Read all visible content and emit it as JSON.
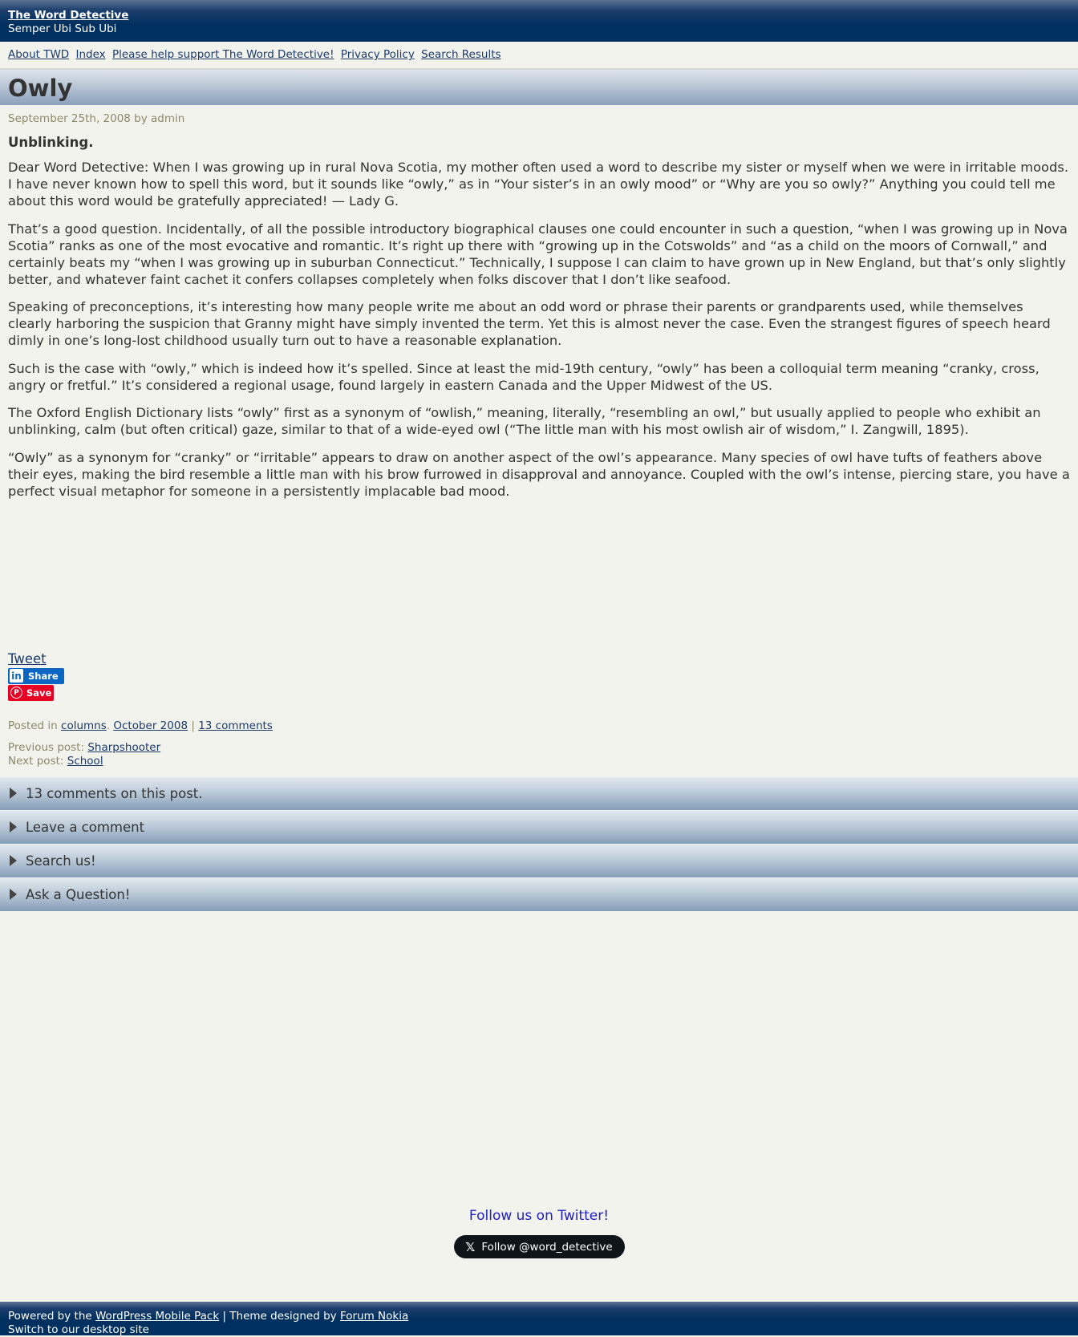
{
  "header": {
    "site_title": "The Word Detective",
    "tagline": "Semper Ubi Sub Ubi"
  },
  "nav": {
    "items": [
      "About TWD",
      "Index",
      "Please help support The Word Detective!",
      "Privacy Policy",
      "Search Results"
    ]
  },
  "post": {
    "title": "Owly",
    "meta": "September 25th, 2008 by admin",
    "subtitle": "Unblinking.",
    "paragraphs": [
      "Dear Word Detective: When I was growing up in rural Nova Scotia, my mother often used a word to describe my sister or myself when we were in irritable moods. I have never known how to spell this word, but it sounds like “owly,” as in “Your sister’s in an owly mood” or “Why are you so owly?” Anything you could tell me about this word would be gratefully appreciated! — Lady G.",
      "That’s a good question. Incidentally, of all the possible introductory biographical clauses one could encounter in such a question, “when I was growing up in Nova Scotia” ranks as one of the most evocative and romantic. It’s right up there with “growing up in the Cotswolds” and “as a child on the moors of Cornwall,” and certainly beats my “when I was growing up in suburban Connecticut.” Technically, I suppose I can claim to have grown up in New England, but that’s only slightly better, and whatever faint cachet it confers collapses completely when folks discover that I don’t like seafood.",
      "Speaking of preconceptions, it’s interesting how many people write me about an odd word or phrase their parents or grandparents used, while themselves clearly harboring the suspicion that Granny might have simply invented the term. Yet this is almost never the case. Even the strangest figures of speech heard dimly in one’s long-lost childhood usually turn out to have a reasonable explanation.",
      "Such is the case with “owly,” which is indeed how it’s spelled. Since at least the mid-19th century, “owly” has been a colloquial term meaning “cranky, cross, angry or fretful.” It’s considered a regional usage, found largely in eastern Canada and the Upper Midwest of the US.",
      "The Oxford English Dictionary lists “owly” first as a synonym of “owlish,” meaning, literally, “resembling an owl,” but usually applied to people who exhibit an unblinking, calm (but often critical) gaze, similar to that of a wide-eyed owl (“The little man with his most owlish air of wisdom,” I. Zangwill, 1895).",
      "“Owly” as a synonym for “cranky” or “irritable” appears to draw on another aspect of the owl’s appearance. Many species of owl have tufts of feathers above their eyes, making the bird resemble a little man with his brow furrowed in disapproval and annoyance. Coupled with the owl’s intense, piercing stare, you have a perfect visual metaphor for someone in a persistently implacable bad mood."
    ]
  },
  "share": {
    "tweet": "Tweet",
    "linkedin_icon": "in",
    "linkedin": "Share",
    "pinterest_icon": "P",
    "pinterest": "Save"
  },
  "post_footer": {
    "posted_in": "Posted in",
    "category": "columns",
    "sep1": ".",
    "month": "October 2008",
    "sep2": "|",
    "comments": "13 comments"
  },
  "post_nav": {
    "previous_label": "Previous post:",
    "previous": "Sharpshooter",
    "next_label": "Next post:",
    "next": "School"
  },
  "sections": [
    "13 comments on this post.",
    "Leave a comment",
    "Search us!",
    "Ask a Question!"
  ],
  "follow": {
    "label": "Follow us on Twitter!",
    "button_icon": "𝕏",
    "button": "Follow @word_detective"
  },
  "footer": {
    "powered_by": "Powered by the",
    "wp_link": "WordPress Mobile Pack",
    "theme_sep": "| Theme designed by",
    "theme_link": "Forum Nokia",
    "switch": "Switch to our desktop site"
  }
}
